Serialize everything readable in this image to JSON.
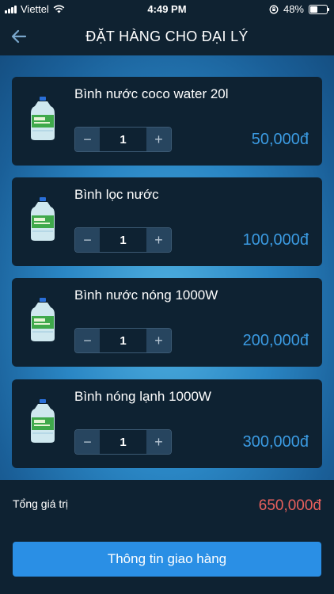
{
  "status_bar": {
    "carrier": "Viettel",
    "time": "4:49 PM",
    "battery": "48%",
    "battery_level": 0.48
  },
  "header": {
    "title": "ĐẶT HÀNG CHO ĐẠI LÝ",
    "back_icon": "arrow-left-icon"
  },
  "products": [
    {
      "name": "Bình nước coco water 20l",
      "quantity": "1",
      "price": "50,000đ"
    },
    {
      "name": "Bình lọc nước",
      "quantity": "1",
      "price": "100,000đ"
    },
    {
      "name": "Bình nước nóng 1000W",
      "quantity": "1",
      "price": "200,000đ"
    },
    {
      "name": "Bình nóng lạnh 1000W",
      "quantity": "1",
      "price": "300,000đ"
    }
  ],
  "stepper": {
    "minus": "−",
    "plus": "+"
  },
  "summary": {
    "total_label": "Tổng giá trị",
    "total_value": "650,000đ"
  },
  "actions": {
    "delivery_info": "Thông tin giao hàng"
  },
  "colors": {
    "background": "#0e2232",
    "price": "#3b9be2",
    "total": "#e9605d",
    "primary_button": "#2a8fe5"
  }
}
